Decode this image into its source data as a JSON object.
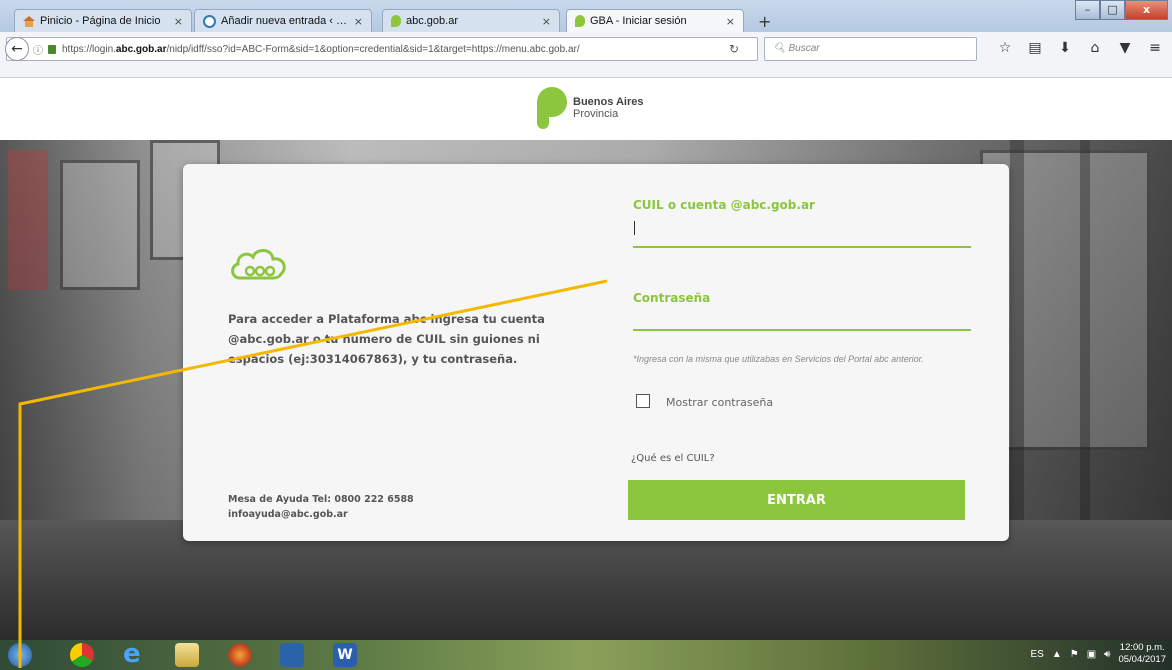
{
  "browser": {
    "tabs": [
      {
        "label": "Pinicio - Página de Inicio",
        "icon": "home-icon",
        "active": false
      },
      {
        "label": "Añadir nueva entrada ‹ — ...",
        "icon": "wordpress-icon",
        "active": false
      },
      {
        "label": "abc.gob.ar",
        "icon": "leaf-icon",
        "active": false
      },
      {
        "label": "GBA - Iniciar sesión",
        "icon": "leaf-icon",
        "active": true
      }
    ],
    "tab_close": "×",
    "new_tab": "+",
    "url_prefix": "https://login.",
    "url_domain": "abc.gob.ar",
    "url_rest": "/nidp/idff/sso?id=ABC-Form&sid=1&option=credential&sid=1&target=https://menu.abc.gob.ar/",
    "search_placeholder": "Buscar"
  },
  "brand": {
    "line1": "Buenos Aires",
    "line2": "Provincia"
  },
  "login": {
    "intro_text": "Para acceder a Plataforma abc ingresa tu cuenta @abc.gob.ar o tu número de CUIL sin guiones ni espacios (ej:30314067863), y tu contraseña.",
    "help_line1": "Mesa de Ayuda Tel: 0800 222 6588",
    "help_line2": "infoayuda@abc.gob.ar",
    "user_label": "CUIL o cuenta @abc.gob.ar",
    "password_label": "Contraseña",
    "note": "*Ingresa con la misma que utilizabas en Servicios del Portal abc anterior.",
    "show_password_label": "Mostrar contraseña",
    "cuil_link": "¿Qué es el CUIL?",
    "submit_label": "ENTRAR"
  },
  "taskbar": {
    "lang": "ES",
    "time": "12:00 p.m.",
    "date": "05/04/2017"
  },
  "colors": {
    "accent": "#8cc63e",
    "annotation": "#f5b800"
  }
}
